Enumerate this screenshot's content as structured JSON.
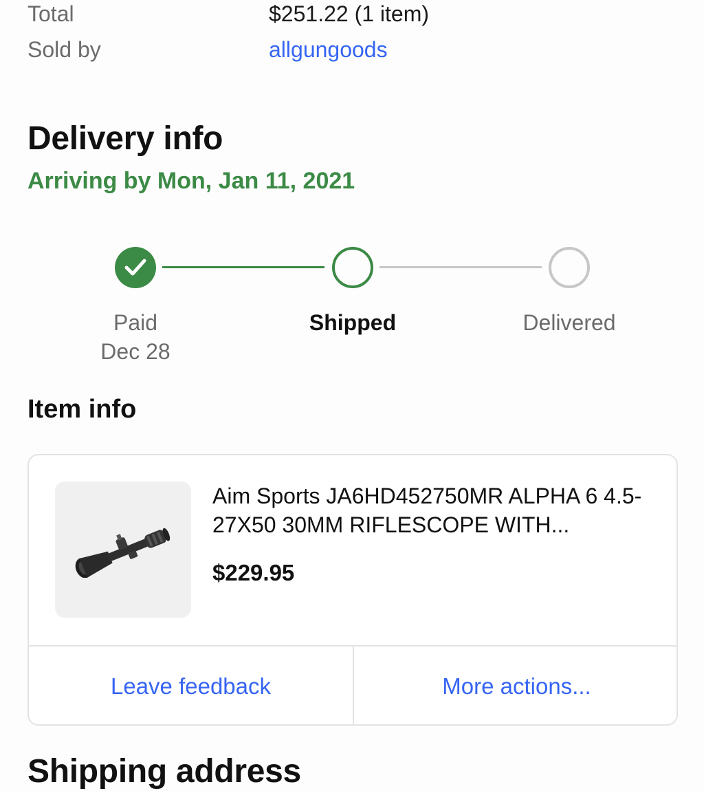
{
  "summary": {
    "total_label": "Total",
    "total_value": "$251.22 (1 item)",
    "sold_by_label": "Sold by",
    "seller": "allgungoods"
  },
  "delivery": {
    "title": "Delivery info",
    "arriving": "Arriving by Mon, Jan 11, 2021",
    "steps": [
      {
        "label": "Paid",
        "date": "Dec 28",
        "state": "complete"
      },
      {
        "label": "Shipped",
        "date": "",
        "state": "current"
      },
      {
        "label": "Delivered",
        "date": "",
        "state": "pending"
      }
    ]
  },
  "item_info": {
    "title": "Item info",
    "item": {
      "name": "Aim Sports JA6HD452750MR ALPHA 6 4.5-27X50 30MM RIFLESCOPE WITH...",
      "price": "$229.95",
      "image_icon": "riflescope-image"
    },
    "actions": {
      "leave_feedback": "Leave feedback",
      "more_actions": "More actions..."
    }
  },
  "shipping": {
    "title": "Shipping address"
  },
  "colors": {
    "accent_green": "#3b8a45",
    "link_blue": "#3665f3",
    "muted_gray": "#6b6b6b",
    "pending_gray": "#c7c7c7"
  }
}
